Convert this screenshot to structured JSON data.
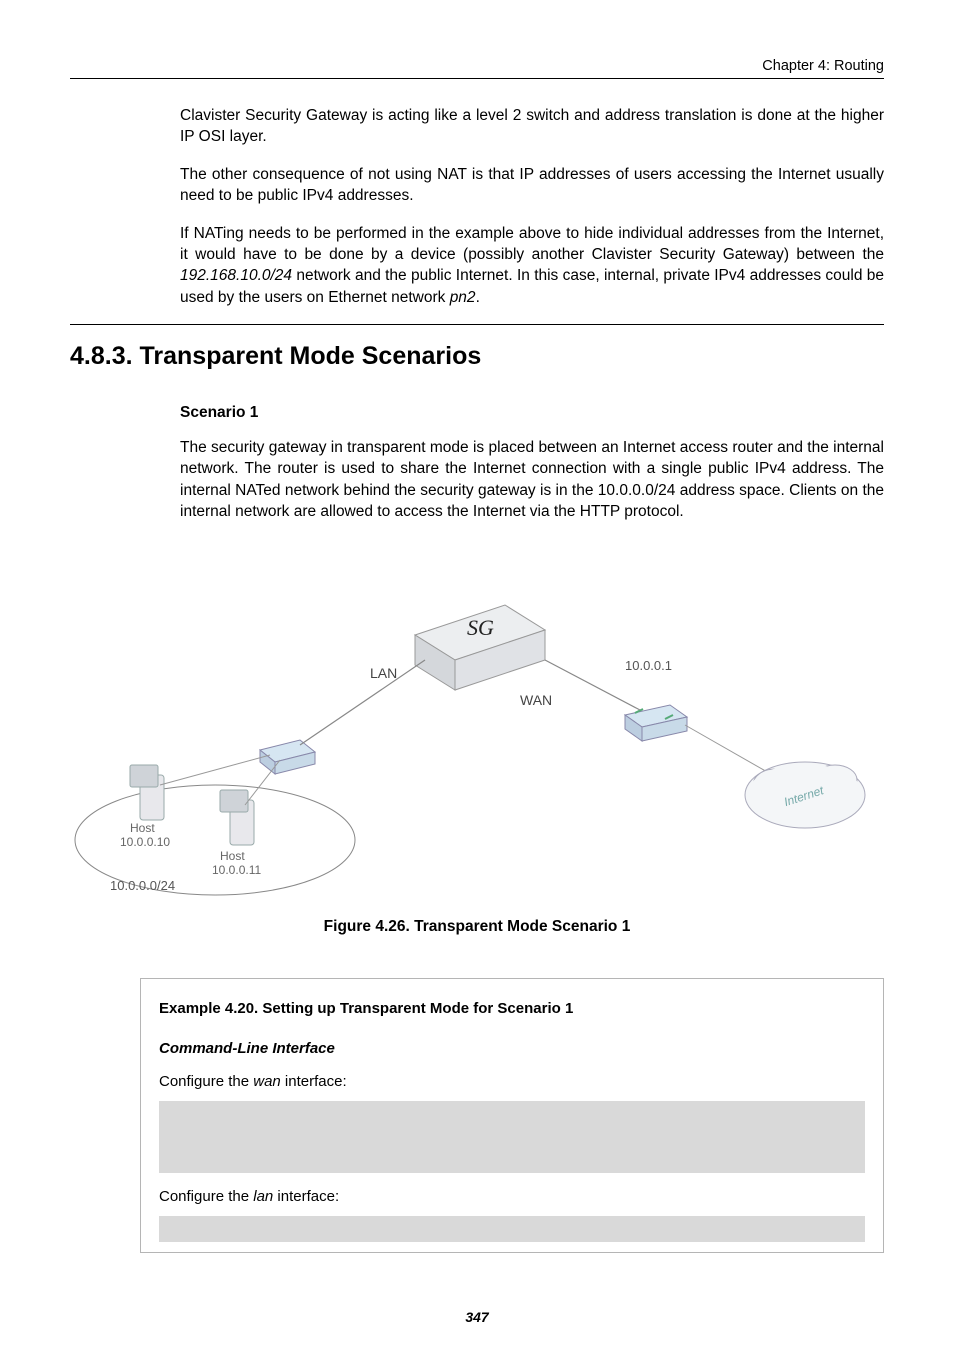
{
  "header": {
    "chapter": "Chapter 4: Routing"
  },
  "intro": {
    "p1a": "Clavister Security Gateway is acting like a level 2 switch and address translation is done at the higher IP OSI layer.",
    "p2": "The other consequence of not using NAT is that IP addresses of users accessing the Internet usually need to be public IPv4 addresses.",
    "p3a": "If NATing needs to be performed in the example above to hide individual addresses from the Internet, it would have to be done by a device (possibly another Clavister Security Gateway) between the ",
    "p3_ip": "192.168.10.0/24",
    "p3b": " network and the public Internet. In this case, internal, private IPv4 addresses could be used by the users on Ethernet network ",
    "p3_pn": "pn2",
    "p3c": "."
  },
  "section": {
    "title": "4.8.3. Transparent Mode Scenarios"
  },
  "scenario": {
    "heading": "Scenario 1",
    "text": "The security gateway in transparent mode is placed between an Internet access router and the internal network. The router is used to share the Internet connection with a single public IPv4 address. The internal NATed network behind the security gateway is in the 10.0.0.0/24 address space. Clients on the internal network are allowed to access the Internet via the HTTP protocol."
  },
  "figure": {
    "sg": "SG",
    "lan": "LAN",
    "wan": "WAN",
    "router_ip": "10.0.0.1",
    "internet": "Internet",
    "hostA_label": "Host",
    "hostA_ip": "10.0.0.10",
    "hostB_label": "Host",
    "hostB_ip": "10.0.0.11",
    "network": "10.0.0.0/24",
    "caption": "Figure 4.26. Transparent Mode Scenario 1"
  },
  "example": {
    "title": "Example 4.20. Setting up Transparent Mode for Scenario 1",
    "cli": "Command-Line Interface",
    "conf_wan_a": "Configure the ",
    "conf_wan_i": "wan",
    "conf_wan_b": " interface:",
    "conf_lan_a": "Configure the ",
    "conf_lan_i": "lan",
    "conf_lan_b": " interface:"
  },
  "page_number": "347"
}
